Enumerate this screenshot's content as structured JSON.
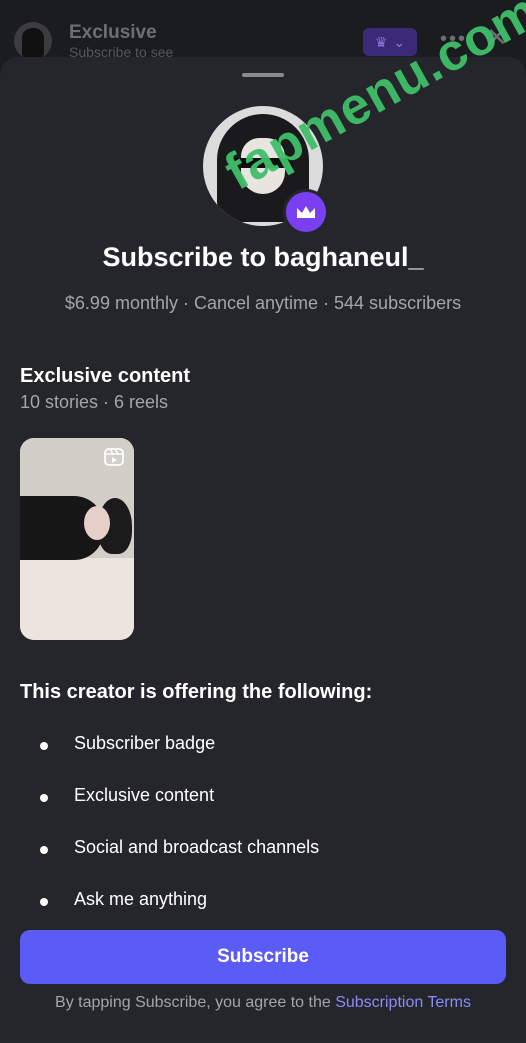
{
  "header": {
    "title": "Exclusive",
    "subtitle": "Subscribe to see",
    "more_icon": "more-icon",
    "close_icon": "close-icon"
  },
  "profile": {
    "avatar": "avatar",
    "badge_icon": "crown-icon"
  },
  "sheet": {
    "title": "Subscribe to baghaneul_",
    "meta": "$6.99 monthly · Cancel anytime · 544 subscribers"
  },
  "exclusive": {
    "title": "Exclusive content",
    "counts": "10 stories · 6 reels",
    "thumbnail_icon": "reels-icon"
  },
  "offer": {
    "title": "This creator is offering the following:",
    "items": [
      "Subscriber badge",
      "Exclusive content",
      "Social and broadcast channels",
      "Ask me anything"
    ]
  },
  "cta": {
    "subscribe_label": "Subscribe"
  },
  "legal": {
    "prefix": "By tapping Subscribe, you agree to the ",
    "link": "Subscription Terms"
  },
  "watermark": "fapmenu.com",
  "colors": {
    "sheet_bg": "#24262b",
    "primary_button": "#5b5cf6",
    "link": "#8b8cf8",
    "secondary_text": "#a3a5ab",
    "crown_badge": "#7b3ff2",
    "watermark": "#3fbf6a"
  }
}
